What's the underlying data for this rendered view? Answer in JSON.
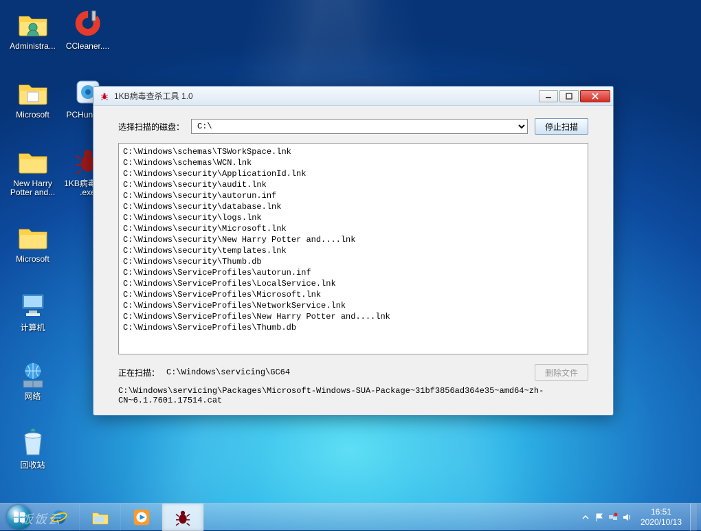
{
  "desktop": {
    "icons": [
      {
        "label": "Administra...",
        "kind": "folder-user"
      },
      {
        "label": "CCleaner....",
        "kind": "ccleaner"
      },
      {
        "label": "Microsoft",
        "kind": "folder"
      },
      {
        "label": "PCHunter...",
        "kind": "pchunter"
      },
      {
        "label": "New Harry Potter and...",
        "kind": "folder"
      },
      {
        "label": "1KB病毒专... .exe",
        "kind": "bug"
      },
      {
        "label": "Microsoft",
        "kind": "folder"
      },
      {
        "label": "计算机",
        "kind": "computer"
      },
      {
        "label": "网络",
        "kind": "network"
      },
      {
        "label": "回收站",
        "kind": "recycle"
      }
    ]
  },
  "window": {
    "title": "1KB病毒查杀工具 1.0",
    "drive_label": "选择扫描的磁盘：",
    "drive_value": "C:\\",
    "stop_button": "停止扫描",
    "results": [
      "C:\\Windows\\schemas\\TSWorkSpace.lnk",
      "C:\\Windows\\schemas\\WCN.lnk",
      "C:\\Windows\\security\\ApplicationId.lnk",
      "C:\\Windows\\security\\audit.lnk",
      "C:\\Windows\\security\\autorun.inf",
      "C:\\Windows\\security\\database.lnk",
      "C:\\Windows\\security\\logs.lnk",
      "C:\\Windows\\security\\Microsoft.lnk",
      "C:\\Windows\\security\\New Harry Potter and....lnk",
      "C:\\Windows\\security\\templates.lnk",
      "C:\\Windows\\security\\Thumb.db",
      "C:\\Windows\\ServiceProfiles\\autorun.inf",
      "C:\\Windows\\ServiceProfiles\\LocalService.lnk",
      "C:\\Windows\\ServiceProfiles\\Microsoft.lnk",
      "C:\\Windows\\ServiceProfiles\\NetworkService.lnk",
      "C:\\Windows\\ServiceProfiles\\New Harry Potter and....lnk",
      "C:\\Windows\\ServiceProfiles\\Thumb.db"
    ],
    "status_label": "正在扫描：",
    "status_path": "C:\\Windows\\servicing\\GC64",
    "delete_button": "删除文件",
    "detail_path": "C:\\Windows\\servicing\\Packages\\Microsoft-Windows-SUA-Package~31bf3856ad364e35~amd64~zh-CN~6.1.7601.17514.cat"
  },
  "taskbar": {
    "watermark": "饭饭云",
    "time": "16:51",
    "date": "2020/10/13"
  }
}
